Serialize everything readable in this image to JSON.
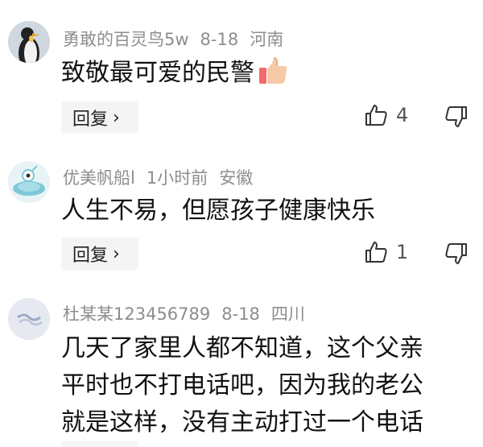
{
  "comments": [
    {
      "username": "勇敢的百灵鸟5w",
      "date": "8-18",
      "location": "河南",
      "text": "致敬最可爱的民警",
      "reply_label": "回复",
      "like_count": "4",
      "avatar": "penguin-avatar",
      "emoji": "thumbs-up-emoji"
    },
    {
      "username": "优美帆船l",
      "date": "1小时前",
      "location": "安徽",
      "text": "人生不易，但愿孩子健康快乐",
      "reply_label": "回复",
      "like_count": "1",
      "avatar": "cartoon-avatar"
    },
    {
      "username": "杜某某123456789",
      "date": "8-18",
      "location": "四川",
      "text_lines": [
        "几天了家里人都不知道，这个父亲",
        "平时也不打电话吧，因为我的老公",
        "就是这样，没有主动打过一个电话"
      ],
      "avatar": "default-avatar"
    }
  ],
  "colors": {
    "meta": "#8d8d8d",
    "reply_bg": "#f4f4f4",
    "text": "#111111"
  }
}
